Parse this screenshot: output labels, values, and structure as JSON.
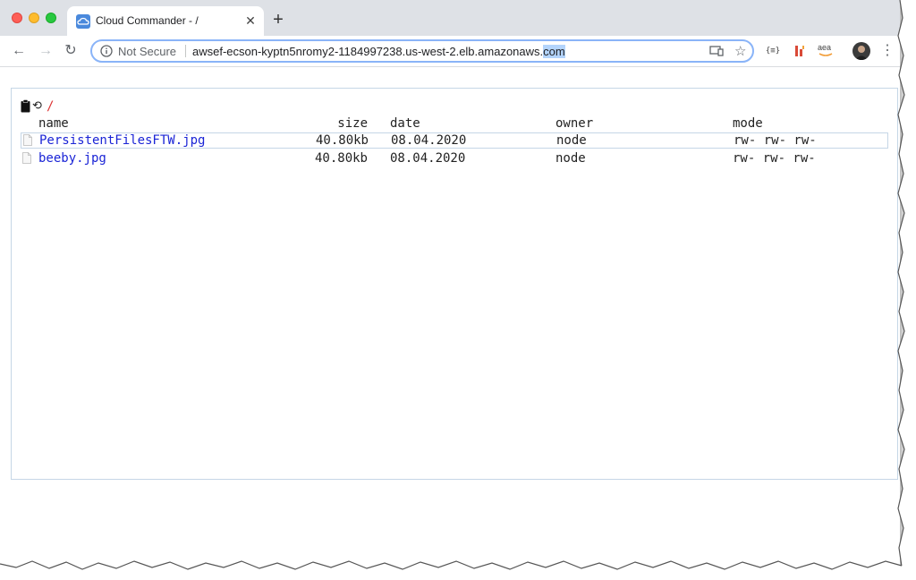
{
  "browser": {
    "tab_title": "Cloud Commander - /",
    "tab_close": "✕",
    "new_tab": "+",
    "security_label": "Not Secure",
    "url_main": "awsef-ecson-kyptn5nromy2-1184997238.us-west-2.elb.amazonaws.",
    "url_selected": "com",
    "extensions": [
      "{≡}",
      "h",
      "aea"
    ]
  },
  "nav": {
    "back": "←",
    "forward": "→",
    "reload": "↻",
    "menu": "⋮",
    "star": "☆"
  },
  "file_manager": {
    "path": "/",
    "refresh_glyph": "⟲",
    "columns": {
      "name": "name",
      "size": "size",
      "date": "date",
      "owner": "owner",
      "mode": "mode"
    },
    "files": [
      {
        "name": "PersistentFilesFTW.jpg",
        "size": "40.80kb",
        "date": "08.04.2020",
        "owner": "node",
        "mode": "rw- rw- rw-",
        "selected": true
      },
      {
        "name": "beeby.jpg",
        "size": "40.80kb",
        "date": "08.04.2020",
        "owner": "node",
        "mode": "rw- rw- rw-",
        "selected": false
      }
    ]
  },
  "colors": {
    "link": "#1a24d6",
    "path": "#dd3333",
    "panel_border": "#c5d6e6",
    "omnibox_focus": "#8ab4f8"
  }
}
